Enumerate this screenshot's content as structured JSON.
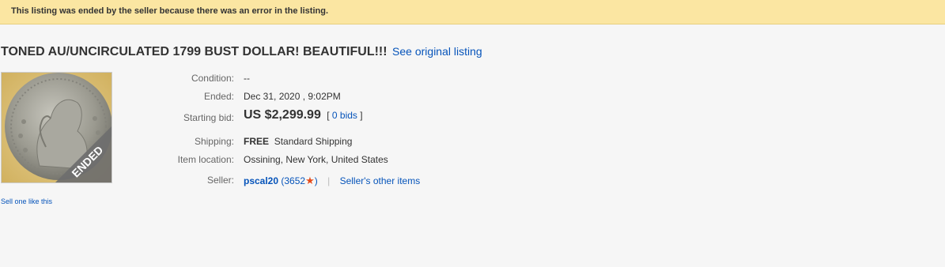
{
  "banner": {
    "message": "This listing was ended by the seller because there was an error in the listing."
  },
  "listing": {
    "title": "TONED AU/UNCIRCULATED 1799 BUST DOLLAR! BEAUTIFUL!!!",
    "see_original": "See original listing",
    "ended_ribbon": "ENDED",
    "sell_one_like_this": "Sell one like this"
  },
  "details": {
    "condition_label": "Condition:",
    "condition_value": "--",
    "ended_label": "Ended:",
    "ended_value": "Dec 31, 2020 , 9:02PM",
    "starting_bid_label": "Starting bid:",
    "starting_bid_value": "US $2,299.99",
    "bids_open": "[",
    "bids_link": "0 bids",
    "bids_close": "]",
    "shipping_label": "Shipping:",
    "shipping_free": "FREE",
    "shipping_method": "Standard Shipping",
    "location_label": "Item location:",
    "location_value": "Ossining, New York, United States",
    "seller_label": "Seller:",
    "seller_name": "pscal20",
    "seller_feedback_open": "(3652",
    "seller_feedback_close": ")",
    "separator": "|",
    "seller_other_items": "Seller's other items"
  },
  "colors": {
    "banner_bg": "#fbe6a2",
    "link": "#0654ba",
    "star": "#e64c1c",
    "ribbon": "#6e6e6e"
  },
  "icons": {
    "feedback_star": "star-icon"
  }
}
